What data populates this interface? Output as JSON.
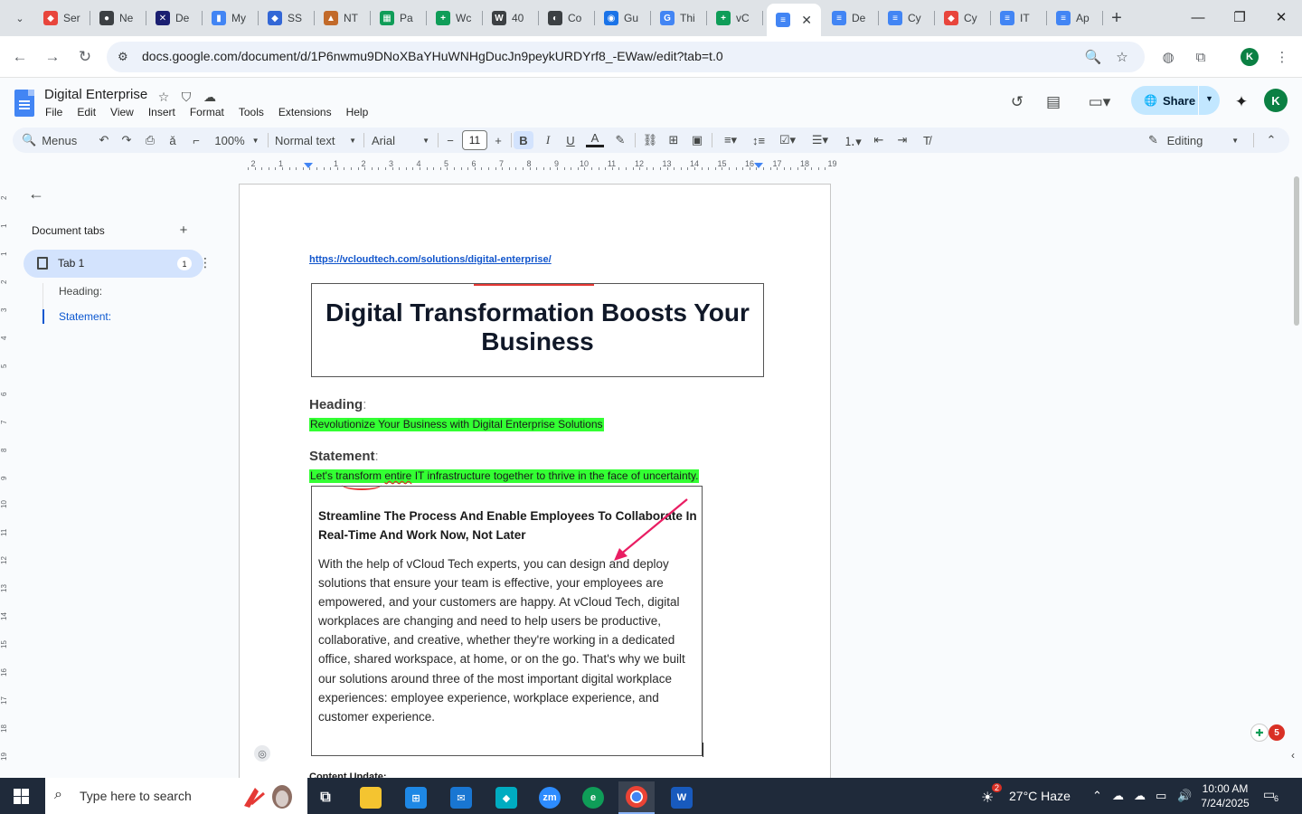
{
  "browser": {
    "tabs": [
      {
        "label": "Ser",
        "color": "#e8453c",
        "glyph": "◆"
      },
      {
        "label": "Ne",
        "color": "#3c4043",
        "glyph": "●"
      },
      {
        "label": "De",
        "color": "#1a1f71",
        "glyph": "✕"
      },
      {
        "label": "My",
        "color": "#4285f4",
        "glyph": "▮"
      },
      {
        "label": "SS",
        "color": "#3367d6",
        "glyph": "◆"
      },
      {
        "label": "NT",
        "color": "#c26a2a",
        "glyph": "▲"
      },
      {
        "label": "Pa",
        "color": "#0f9d58",
        "glyph": "▦"
      },
      {
        "label": "Wc",
        "color": "#0f9d58",
        "glyph": "+"
      },
      {
        "label": "40",
        "color": "#3c4043",
        "glyph": "W"
      },
      {
        "label": "Co",
        "color": "#3c4043",
        "glyph": "◐"
      },
      {
        "label": "Gu",
        "color": "#1a73e8",
        "glyph": "◉"
      },
      {
        "label": "Thi",
        "color": "#4285f4",
        "glyph": "G"
      },
      {
        "label": "vC",
        "color": "#0f9d58",
        "glyph": "+"
      },
      {
        "label": "",
        "color": "#4285f4",
        "glyph": "≡",
        "active": true
      },
      {
        "label": "De",
        "color": "#4285f4",
        "glyph": "≡"
      },
      {
        "label": "Cy",
        "color": "#4285f4",
        "glyph": "≡"
      },
      {
        "label": "Cy",
        "color": "#e8453c",
        "glyph": "◆"
      },
      {
        "label": "IT",
        "color": "#4285f4",
        "glyph": "≡"
      },
      {
        "label": "Ap",
        "color": "#4285f4",
        "glyph": "≡"
      }
    ],
    "url": "docs.google.com/document/d/1P6nwmu9DNoXBaYHuWNHgDucJn9peykURDYrf8_-EWaw/edit?tab=t.0",
    "profile_initial": "K"
  },
  "docs": {
    "title": "Digital Enterprise",
    "menu": [
      "File",
      "Edit",
      "View",
      "Insert",
      "Format",
      "Tools",
      "Extensions",
      "Help"
    ],
    "share_label": "Share",
    "account_initial": "K"
  },
  "format_toolbar": {
    "menus_label": "Menus",
    "zoom": "100%",
    "style": "Normal text",
    "font": "Arial",
    "font_size": "11",
    "mode": "Editing"
  },
  "ruler": {
    "numbers": [
      "2",
      "1",
      "1",
      "2",
      "3",
      "4",
      "5",
      "6",
      "7",
      "8",
      "9",
      "10",
      "11",
      "12",
      "13",
      "14",
      "15",
      "16",
      "17",
      "18",
      "19"
    ],
    "vertical_numbers": [
      "2",
      "1",
      "1",
      "2",
      "3",
      "4",
      "5",
      "6",
      "7",
      "8",
      "9",
      "10",
      "11",
      "12",
      "13",
      "14",
      "15",
      "16",
      "17",
      "18",
      "19"
    ]
  },
  "sidebar": {
    "section_title": "Document tabs",
    "tab_label": "Tab 1",
    "tab_badge": "1",
    "outline": [
      "Heading:",
      "Statement:"
    ]
  },
  "document": {
    "link": "https://vcloudtech.com/solutions/digital-enterprise/",
    "hero_title": "Digital Transformation Boosts Your Business",
    "heading_label": "Heading",
    "heading_text": "Revolutionize Your Business with Digital Enterprise Solutions",
    "statement_label": "Statement",
    "statement_text_a": "Let's transform ",
    "statement_text_b": "entire",
    "statement_text_c": " IT infrastructure together to thrive in the face of uncertainty.",
    "box_title": "Streamline The Process And Enable Employees To Collaborate In Real-Time And Work Now, Not Later",
    "box_body": "With the help of vCloud Tech experts, you can design and deploy solutions that ensure your team is effective, your employees are empowered, and your customers are happy. At vCloud Tech, digital workplaces are changing and need to help users be productive, collaborative, and creative, whether they're working in a dedicated office, shared workspace, at home, or on the go. That's why we built our solutions around three of the most important digital workplace experiences: employee experience, workplace experience, and customer experience.",
    "next_section": "Content Update:"
  },
  "floating": {
    "badge_count": "5"
  },
  "taskbar": {
    "search_placeholder": "Type here to search",
    "weather_badge": "2",
    "weather": "27°C  Haze",
    "time": "10:00 AM",
    "date": "7/24/2025",
    "notifications": "6"
  }
}
